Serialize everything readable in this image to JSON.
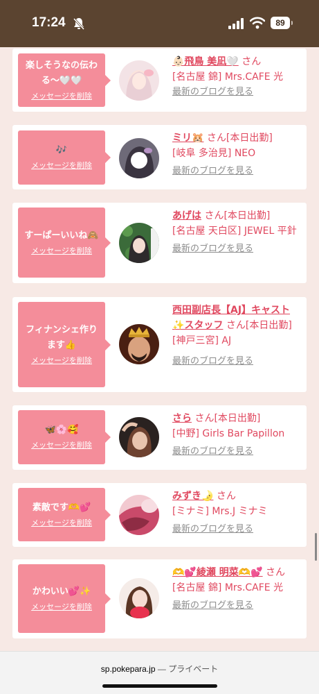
{
  "status_bar": {
    "time": "17:24",
    "battery": "89"
  },
  "cards": [
    {
      "message": "楽しそうなの伝わる〜🤍🤍",
      "delete_label": "メッセージを削除",
      "name": "👶🏻飛鳥 美凪🤍",
      "san": " さん",
      "shop": "[名古屋 錦] Mrs.CAFE 光",
      "blog_label": "最新のブログを見る"
    },
    {
      "message": "🎶",
      "delete_label": "メッセージを削除",
      "name": "ミリ🐹",
      "san": " さん[本日出勤]",
      "shop": "[岐阜 多治見] NEO",
      "blog_label": "最新のブログを見る"
    },
    {
      "message": "すーぱーいいね🙈",
      "delete_label": "メッセージを削除",
      "name": "あげは",
      "san": " さん[本日出勤]",
      "shop": "[名古屋 天白区] JEWEL 平針",
      "blog_label": "最新のブログを見る"
    },
    {
      "message": "フィナンシェ作ります👍",
      "delete_label": "メッセージを削除",
      "name": "西田副店長【AJ】キャスト✨スタッフ",
      "san": " さん[本日出勤]",
      "shop": "[神戸三宮] AJ",
      "blog_label": "最新のブログを見る"
    },
    {
      "message": "🦋🌸🥰",
      "delete_label": "メッセージを削除",
      "name": "さら",
      "san": " さん[本日出勤]",
      "shop": "[中野] Girls Bar Papillon",
      "blog_label": "最新のブログを見る"
    },
    {
      "message": "素敵です🫶💕",
      "delete_label": "メッセージを削除",
      "name": "みずき🌛",
      "san": " さん",
      "shop": "[ミナミ] Mrs.J ミナミ",
      "blog_label": "最新のブログを見る"
    },
    {
      "message": "かわいい💕✨",
      "delete_label": "メッセージを削除",
      "name": "🫶💕綾瀬 明菜🫶💕",
      "san": " さん",
      "shop": "[名古屋 錦] Mrs.CAFE 光",
      "blog_label": "最新のブログを見る"
    }
  ],
  "url_bar": {
    "host": "sp.pokepara.jp",
    "separator": " — ",
    "mode": "プライベート"
  },
  "colors": {
    "status_bg": "#5b4430",
    "page_bg": "#f7e9e5",
    "bubble": "#f48d9a",
    "accent": "#e0485f",
    "link_grey": "#8d8d8d"
  }
}
